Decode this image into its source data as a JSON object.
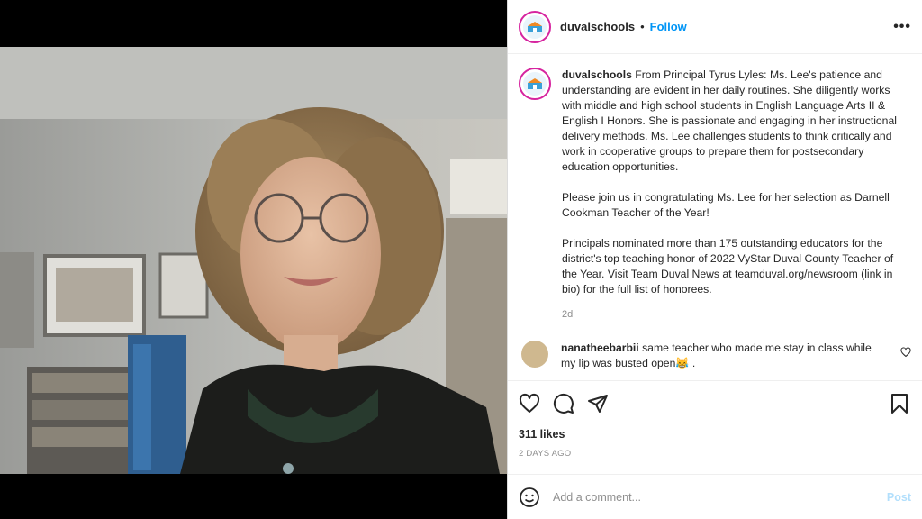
{
  "post": {
    "username": "duvalschools",
    "separator": "•",
    "follow_label": "Follow",
    "more_label": "•••",
    "caption_user": "duvalschools",
    "caption_p1": "From Principal Tyrus Lyles: Ms. Lee's patience and understanding are evident in her daily routines. She diligently works with middle and high school students in English Language Arts II & English I Honors. She is passionate and engaging in her instructional delivery methods. Ms. Lee challenges students to think critically and work in cooperative groups to prepare them for postsecondary education opportunities.",
    "caption_p2": "Please join us in congratulating Ms. Lee for her selection as Darnell Cookman Teacher of the Year!",
    "caption_p3": "Principals nominated more than 175 outstanding educators for the district's top teaching honor of 2022 VyStar Duval County Teacher of the Year. Visit Team Duval News at teamduval.org/newsroom (link in bio) for the full list of honorees.",
    "caption_time": "2d"
  },
  "comment": {
    "user": "nanatheebarbii",
    "text": "same teacher who made me stay in class while my lip was busted open😹 ."
  },
  "actions": {
    "likes": "311 likes",
    "date": "2 DAYS AGO"
  },
  "add_comment": {
    "placeholder": "Add a comment...",
    "post_label": "Post"
  },
  "colors": {
    "link_blue": "#0095f6",
    "post_disabled": "#b2dffc",
    "muted": "#8e8e8e"
  },
  "icons": [
    "heart-icon",
    "comment-icon",
    "share-icon",
    "bookmark-icon",
    "emoji-icon",
    "more-icon"
  ]
}
